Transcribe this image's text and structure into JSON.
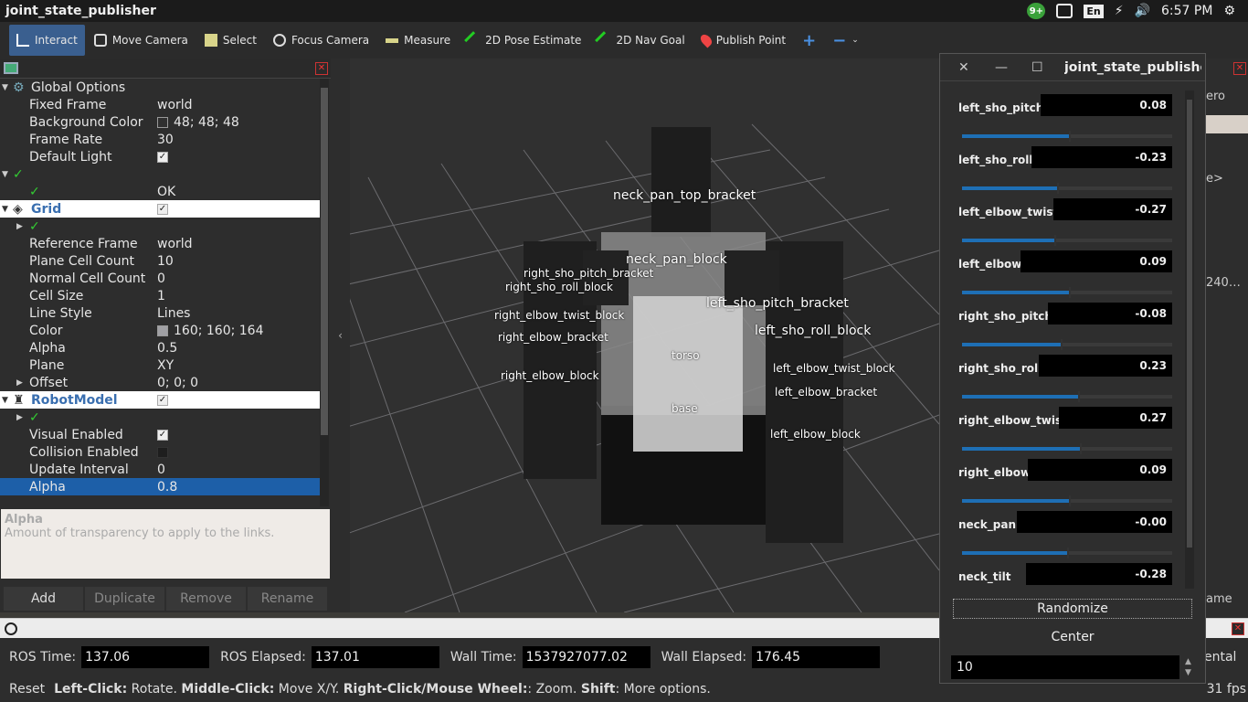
{
  "topbar": {
    "title": "joint_state_publisher",
    "clock": "6:57 PM",
    "lang": "En",
    "badge": "9+"
  },
  "toolbar": {
    "items": [
      {
        "label": "Interact",
        "icon": "hand-icon"
      },
      {
        "label": "Move Camera",
        "icon": "camera-icon"
      },
      {
        "label": "Select",
        "icon": "select-icon"
      },
      {
        "label": "Focus Camera",
        "icon": "crosshair-icon"
      },
      {
        "label": "Measure",
        "icon": "ruler-icon"
      },
      {
        "label": "2D Pose Estimate",
        "icon": "arrow-green-icon"
      },
      {
        "label": "2D Nav Goal",
        "icon": "arrow-green-icon"
      },
      {
        "label": "Publish Point",
        "icon": "pin-icon"
      }
    ]
  },
  "displays": {
    "global_options": "Global Options",
    "fixed_frame_k": "Fixed Frame",
    "fixed_frame_v": "world",
    "bg_color_k": "Background Color",
    "bg_color_v": "48; 48; 48",
    "frame_rate_k": "Frame Rate",
    "frame_rate_v": "30",
    "default_light_k": "Default Light",
    "ok_v": "OK",
    "grid": "Grid",
    "ref_frame_k": "Reference Frame",
    "ref_frame_v": "world",
    "plane_cell_k": "Plane Cell Count",
    "plane_cell_v": "10",
    "normal_cell_k": "Normal Cell Count",
    "normal_cell_v": "0",
    "cell_size_k": "Cell Size",
    "cell_size_v": "1",
    "line_style_k": "Line Style",
    "line_style_v": "Lines",
    "color_k": "Color",
    "color_v": "160; 160; 164",
    "alpha_k": "Alpha",
    "alpha_v": "0.5",
    "plane_k": "Plane",
    "plane_v": "XY",
    "offset_k": "Offset",
    "offset_v": "0; 0; 0",
    "robot_model": "RobotModel",
    "visual_k": "Visual Enabled",
    "collision_k": "Collision Enabled",
    "update_k": "Update Interval",
    "update_v": "0",
    "alpha2_k": "Alpha",
    "alpha2_v": "0.8"
  },
  "description": {
    "title": "Alpha",
    "text": "Amount of transparency to apply to the links."
  },
  "buttons": {
    "add": "Add",
    "duplicate": "Duplicate",
    "remove": "Remove",
    "rename": "Rename"
  },
  "scene_labels": {
    "a": "neck_pan_top_bracket",
    "b": "neck_pan_block",
    "c": "right_sho_pitch_bracket",
    "d": "right_sho_roll_block",
    "e": "right_elbow_twist_block",
    "f": "right_elbow_bracket",
    "g": "right_elbow_block",
    "h": "left_sho_pitch_bracket",
    "i": "left_sho_roll_block",
    "j": "left_elbow_twist_block",
    "k": "left_elbow_bracket",
    "l": "left_elbow_block",
    "m": "torso",
    "n": "base"
  },
  "jsp": {
    "title": "joint_state_publisher",
    "joints": [
      {
        "name": "left_sho_pitch",
        "value": "0.08",
        "level": 0.51
      },
      {
        "name": "left_sho_roll",
        "value": "-0.23",
        "level": 0.45
      },
      {
        "name": "left_elbow_twist",
        "value": "-0.27",
        "level": 0.44
      },
      {
        "name": "left_elbow",
        "value": "0.09",
        "level": 0.51
      },
      {
        "name": "right_sho_pitch",
        "value": "-0.08",
        "level": 0.47
      },
      {
        "name": "right_sho_roll",
        "value": "0.23",
        "level": 0.55
      },
      {
        "name": "right_elbow_twist",
        "value": "0.27",
        "level": 0.56
      },
      {
        "name": "right_elbow",
        "value": "0.09",
        "level": 0.51
      },
      {
        "name": "neck_pan",
        "value": "-0.00",
        "level": 0.5
      },
      {
        "name": "neck_tilt",
        "value": "-0.28",
        "level": 0.43
      }
    ],
    "randomize": "Randomize",
    "center": "Center",
    "spin": "10"
  },
  "time": {
    "ros_time_l": "ROS Time:",
    "ros_time": "137.06",
    "ros_elapsed_l": "ROS Elapsed:",
    "ros_elapsed": "137.01",
    "wall_time_l": "Wall Time:",
    "wall_time": "1537927077.02",
    "wall_elapsed_l": "Wall Elapsed:",
    "wall_elapsed": "176.45"
  },
  "status": {
    "reset": "Reset",
    "left": "Left-Click:",
    "left_t": " Rotate. ",
    "middle": "Middle-Click:",
    "middle_t": " Move X/Y. ",
    "right": "Right-Click/Mouse Wheel:",
    "right_t": ": Zoom. ",
    "shift": "Shift",
    "shift_t": ": More options.",
    "fps": "31 fps"
  },
  "right_side": {
    "a": "ero",
    "b": "e>",
    "c": "240…",
    "d": "ame",
    "e": "ental"
  },
  "colors": {
    "accent": "#1d5fa8",
    "grid_bg": "#303030",
    "slider": "#1e6fb5"
  }
}
